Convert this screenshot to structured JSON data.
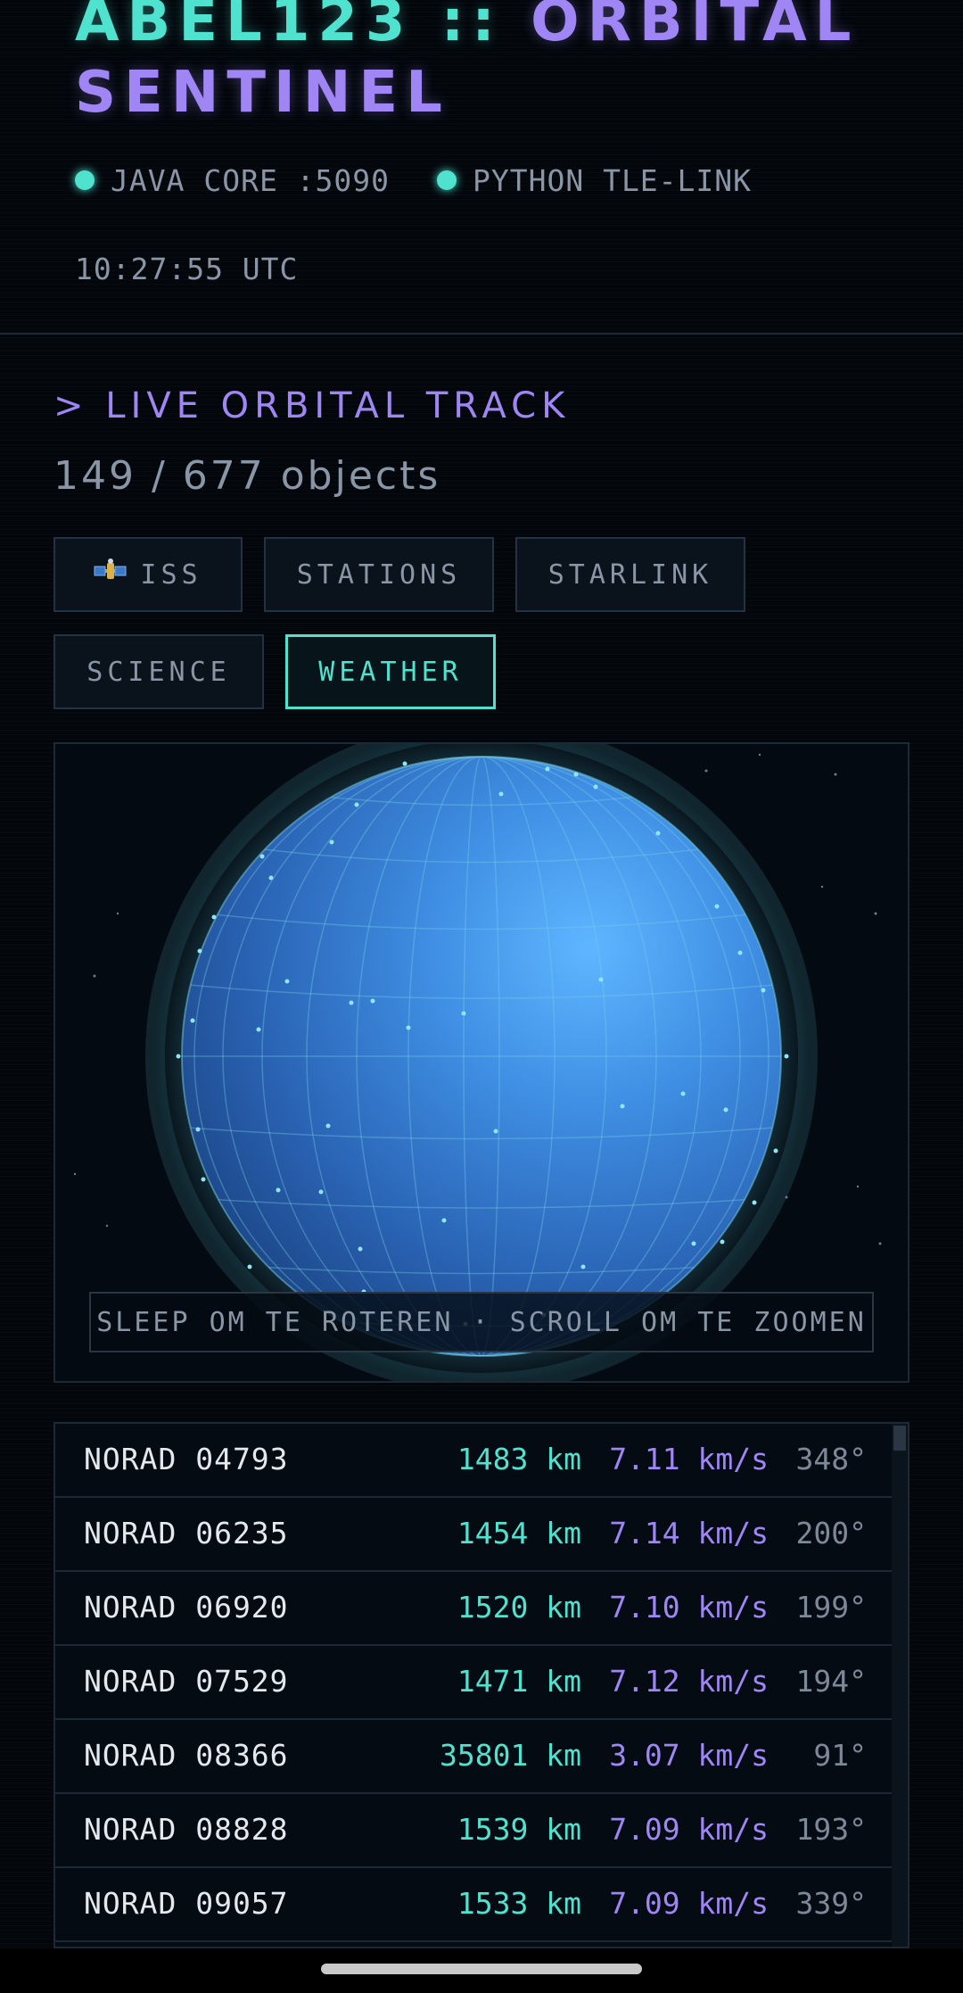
{
  "header": {
    "title_part1": "ABEL123 ::",
    "title_part2": "ORBITAL SENTINEL",
    "status_java": "JAVA CORE :5090",
    "status_python": "PYTHON TLE-LINK",
    "clock": "10:27:55 UTC"
  },
  "section": {
    "title": "> LIVE ORBITAL TRACK",
    "count": "149 / 677 objects"
  },
  "filters": [
    {
      "label": "ISS",
      "icon": "satellite-icon",
      "active": false
    },
    {
      "label": "STATIONS",
      "active": false
    },
    {
      "label": "STARLINK",
      "active": false
    },
    {
      "label": "SCIENCE",
      "active": false
    },
    {
      "label": "WEATHER",
      "active": true
    }
  ],
  "globe": {
    "hint": "SLEEP OM TE ROTEREN · SCROLL OM TE ZOOMEN"
  },
  "objects": [
    {
      "name": "NORAD 04793",
      "altitude": "1483 km",
      "velocity": "7.11 km/s",
      "heading": "348°"
    },
    {
      "name": "NORAD 06235",
      "altitude": "1454 km",
      "velocity": "7.14 km/s",
      "heading": "200°"
    },
    {
      "name": "NORAD 06920",
      "altitude": "1520 km",
      "velocity": "7.10 km/s",
      "heading": "199°"
    },
    {
      "name": "NORAD 07529",
      "altitude": "1471 km",
      "velocity": "7.12 km/s",
      "heading": "194°"
    },
    {
      "name": "NORAD 08366",
      "altitude": "35801 km",
      "velocity": "3.07 km/s",
      "heading": "91°"
    },
    {
      "name": "NORAD 08828",
      "altitude": "1539 km",
      "velocity": "7.09 km/s",
      "heading": "193°"
    },
    {
      "name": "NORAD 09057",
      "altitude": "1533 km",
      "velocity": "7.09 km/s",
      "heading": "339°"
    }
  ],
  "colors": {
    "accent_teal": "#4fe2cf",
    "accent_purple": "#9f86f4",
    "background": "#03070c"
  }
}
